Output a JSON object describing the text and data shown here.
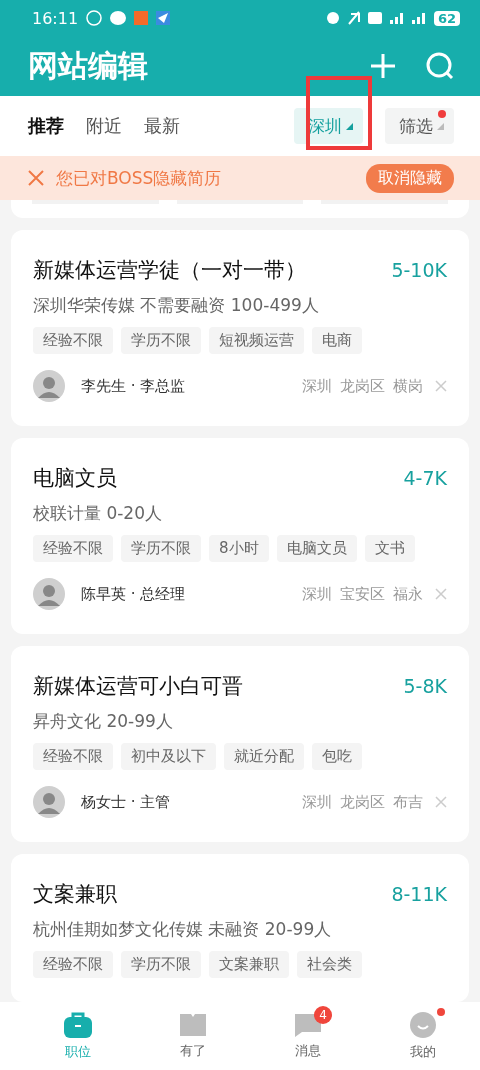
{
  "status_bar": {
    "time": "16:11",
    "battery": "62"
  },
  "header": {
    "title": "网站编辑"
  },
  "tabs": [
    {
      "label": "推荐",
      "selected": true
    },
    {
      "label": "附近",
      "selected": false
    },
    {
      "label": "最新",
      "selected": false
    }
  ],
  "city_filter": {
    "label": "深圳",
    "highlighted": true
  },
  "filter_button": {
    "label": "筛选",
    "has_dot": true
  },
  "banner": {
    "text": "您已对BOSS隐藏简历",
    "action": "取消隐藏"
  },
  "jobs": [
    {
      "title": "新媒体运营学徒（一对一带）",
      "salary": "5-10K",
      "company": "深圳华荣传媒 不需要融资 100-499人",
      "tags": [
        "经验不限",
        "学历不限",
        "短视频运营",
        "电商"
      ],
      "recruiter": "李先生 · 李总监",
      "location": [
        "深圳",
        "龙岗区",
        "横岗"
      ]
    },
    {
      "title": "电脑文员",
      "salary": "4-7K",
      "company": "校联计量 0-20人",
      "tags": [
        "经验不限",
        "学历不限",
        "8小时",
        "电脑文员",
        "文书"
      ],
      "recruiter": "陈早英 · 总经理",
      "location": [
        "深圳",
        "宝安区",
        "福永"
      ]
    },
    {
      "title": "新媒体运营可小白可晋",
      "salary": "5-8K",
      "company": "昇舟文化 20-99人",
      "tags": [
        "经验不限",
        "初中及以下",
        "就近分配",
        "包吃"
      ],
      "recruiter": "杨女士 · 主管",
      "location": [
        "深圳",
        "龙岗区",
        "布吉"
      ]
    },
    {
      "title": "文案兼职",
      "salary": "8-11K",
      "company": "杭州佳期如梦文化传媒 未融资 20-99人",
      "tags": [
        "经验不限",
        "学历不限",
        "文案兼职",
        "社会类"
      ]
    }
  ],
  "nav": [
    {
      "label": "职位",
      "selected": true,
      "kind": "bag",
      "dot": false
    },
    {
      "label": "有了",
      "selected": false,
      "kind": "book",
      "dot": false
    },
    {
      "label": "消息",
      "selected": false,
      "kind": "chat",
      "badge": "4",
      "dot": false
    },
    {
      "label": "我的",
      "selected": false,
      "kind": "face",
      "dot": true
    }
  ]
}
